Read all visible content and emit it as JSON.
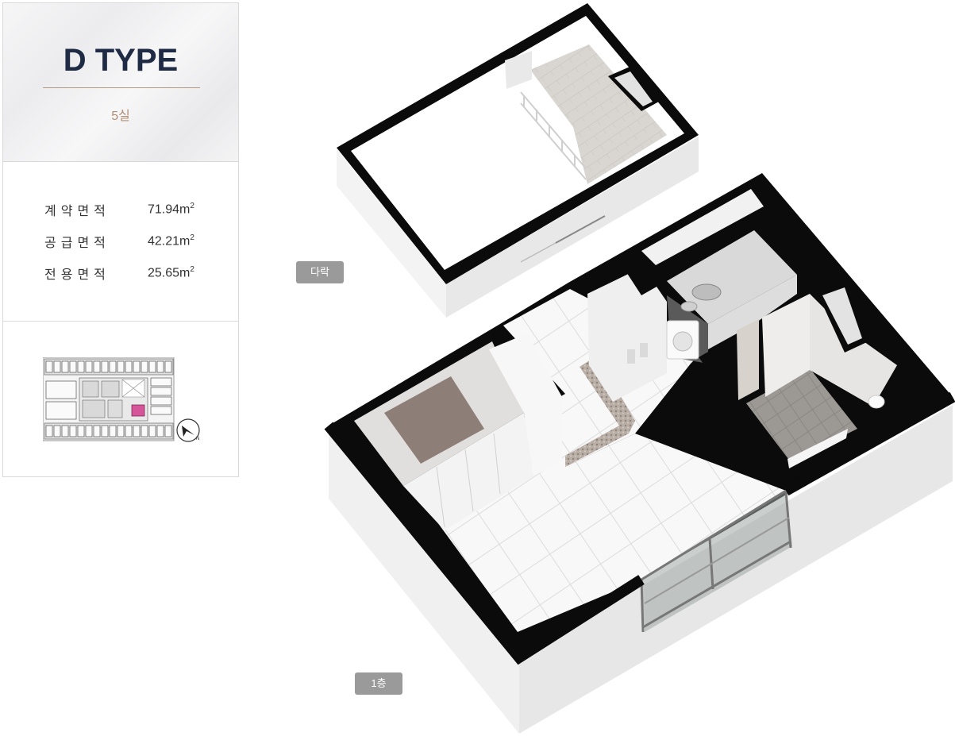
{
  "unit": {
    "type_title": "D TYPE",
    "rooms": "5실"
  },
  "areas": [
    {
      "label": "계약면적",
      "value": "71.94",
      "unit": "m2"
    },
    {
      "label": "공급면적",
      "value": "42.21",
      "unit": "m2"
    },
    {
      "label": "전용면적",
      "value": "25.65",
      "unit": "m2"
    }
  ],
  "tags": {
    "loft": "다락",
    "first_floor": "1층"
  },
  "colors": {
    "title": "#1f2a44",
    "accent": "#b08f78",
    "tag_bg": "#9a9a9a",
    "wall": "#0d0d0d",
    "highlight": "#d6559a"
  },
  "icons": {
    "compass": "compass-arrow-icon"
  }
}
